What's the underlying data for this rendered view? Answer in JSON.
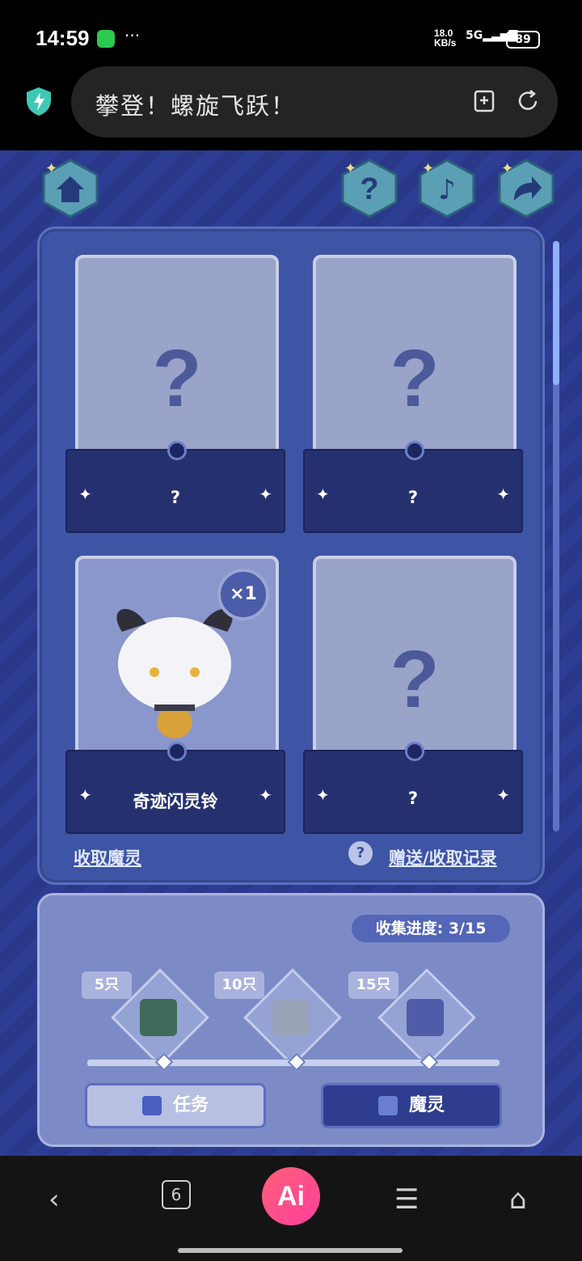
{
  "status_bar": {
    "time": "14:59",
    "net_speed": "18.0\nKB/s",
    "signal": "5G",
    "battery": "89"
  },
  "browser": {
    "title": "攀登！螺旋飞跃！"
  },
  "cards": [
    {
      "label": "?"
    },
    {
      "label": "?"
    },
    {
      "label": "奇迹闪灵铃",
      "count": "×1"
    },
    {
      "label": "?"
    }
  ],
  "links": {
    "collect": "收取魔灵",
    "record": "赠送/收取记录",
    "help": "?"
  },
  "progress": {
    "label": "收集进度:",
    "value": "3/15"
  },
  "rewards": [
    {
      "tag": "5只",
      "icon": "book-icon"
    },
    {
      "tag": "10只",
      "icon": "hourglass-icon"
    },
    {
      "tag": "15只",
      "icon": "cat-box-icon"
    }
  ],
  "tabs": {
    "tasks": "任务",
    "spirits": "魔灵"
  },
  "nav": {
    "tabs_count": "6",
    "ai": "Ai"
  },
  "colors": {
    "accent": "#3e54a5",
    "background": "#2b3a8f"
  }
}
